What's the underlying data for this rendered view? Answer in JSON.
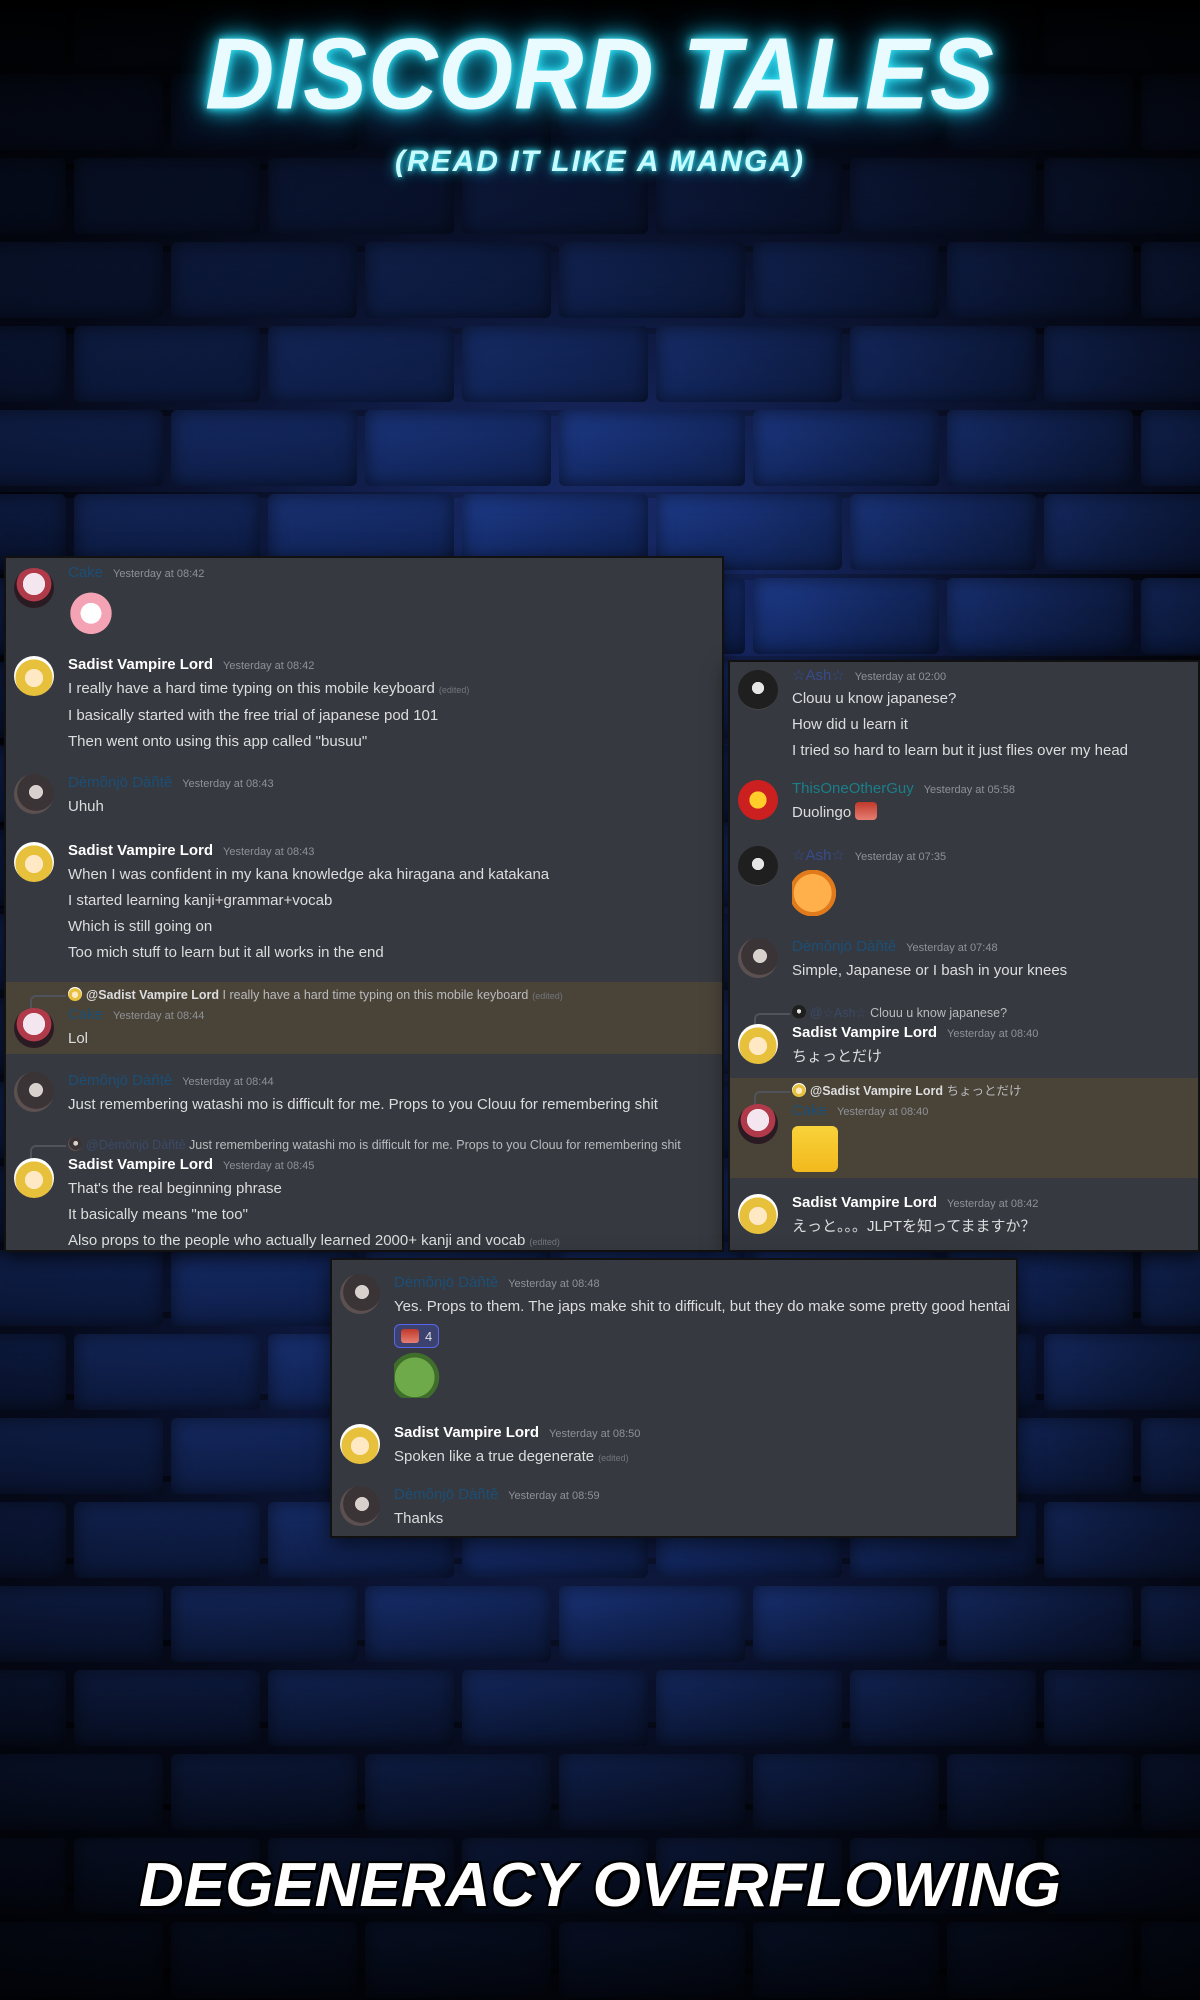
{
  "header": {
    "title": "DISCORD TALES",
    "subtitle": "(READ IT LIKE A MANGA)"
  },
  "footer": {
    "caption": "DEGENERACY OVERFLOWING"
  },
  "colors": {
    "background": "#0a1230",
    "panel": "#36393f",
    "highlight": "#4a4338",
    "neon": "#3ff0ff"
  },
  "panel_left": {
    "messages": [
      {
        "author": "Cake",
        "timestamp": "Yesterday at 08:42",
        "sticker": "cat-sticker"
      },
      {
        "author": "Sadist Vampire Lord",
        "timestamp": "Yesterday at 08:42",
        "lines": [
          "I really have a hard time typing on this mobile keyboard",
          "I basically started with the free trial of japanese pod 101",
          "Then went onto using this app called \"busuu\""
        ],
        "edited_tag": "(edited)"
      },
      {
        "author": "Dèmõnjö Dàñtê",
        "timestamp": "Yesterday at 08:43",
        "lines": [
          "Uhuh"
        ]
      },
      {
        "author": "Sadist Vampire Lord",
        "timestamp": "Yesterday at 08:43",
        "lines": [
          "When I was confident in my kana knowledge aka hiragana and katakana",
          "I started learning kanji+grammar+vocab",
          "Which is still going on",
          "Too mich stuff to learn but it all works in the end"
        ]
      },
      {
        "reply_author": "@Sadist Vampire Lord",
        "reply_text": "I really have a hard time typing on this mobile keyboard",
        "reply_edited": "(edited)",
        "author": "Cake",
        "timestamp": "Yesterday at 08:44",
        "lines": [
          "Lol"
        ]
      },
      {
        "author": "Dèmõnjö Dàñtê",
        "timestamp": "Yesterday at 08:44",
        "lines": [
          "Just remembering watashi mo is difficult for me. Props to you Clouu for remembering shit"
        ]
      },
      {
        "reply_author": "@Dèmõnjö Dàñtê",
        "reply_text": "Just remembering watashi mo is difficult for me. Props to you Clouu for remembering shit",
        "author": "Sadist Vampire Lord",
        "timestamp": "Yesterday at 08:45",
        "lines": [
          "That's the real beginning phrase",
          "It basically means \"me too\"",
          "Also props to the people who actually learned 2000+ kanji and vocab"
        ],
        "edited_tag": "(edited)"
      }
    ]
  },
  "panel_right": {
    "messages": [
      {
        "author": "☆Ash☆",
        "timestamp": "Yesterday at 02:00",
        "lines": [
          "Clouu u know japanese?",
          "How did u learn it",
          "I tried so hard to learn but it just flies over my head"
        ]
      },
      {
        "author": "ThisOneOtherGuy",
        "timestamp": "Yesterday at 05:58",
        "lines": [
          "Duolingo"
        ]
      },
      {
        "author": "☆Ash☆",
        "timestamp": "Yesterday at 07:35",
        "sticker": "pufferfish-sticker"
      },
      {
        "author": "Dèmõnjö Dàñtê",
        "timestamp": "Yesterday at 07:48",
        "lines": [
          "Simple, Japanese or I bash in your knees"
        ]
      },
      {
        "reply_author": "@☆Ash☆",
        "reply_text": "Clouu u know japanese?",
        "author": "Sadist Vampire Lord",
        "timestamp": "Yesterday at 08:40",
        "lines": [
          "ちょっとだけ"
        ]
      },
      {
        "reply_author": "@Sadist Vampire Lord",
        "reply_text": "ちょっとだけ",
        "author": "Cake",
        "timestamp": "Yesterday at 08:40",
        "sticker": "pikachu-sticker"
      },
      {
        "author": "Sadist Vampire Lord",
        "timestamp": "Yesterday at 08:42",
        "lines": [
          "えっと。。。JLPTを知ってまますか？"
        ]
      }
    ]
  },
  "panel_bottom": {
    "messages": [
      {
        "author": "Dèmõnjö Dàñtê",
        "timestamp": "Yesterday at 08:48",
        "lines": [
          "Yes. Props to them. The japs make shit to difficult, but they do make some pretty good hentai"
        ],
        "reaction_count": "4",
        "sticker": "frog-sticker"
      },
      {
        "author": "Sadist Vampire Lord",
        "timestamp": "Yesterday at 08:50",
        "lines": [
          "Spoken like a true degenerate"
        ],
        "edited_tag": "(edited)"
      },
      {
        "author": "Dèmõnjö Dàñtê",
        "timestamp": "Yesterday at 08:59",
        "lines": [
          "Thanks"
        ]
      }
    ]
  }
}
